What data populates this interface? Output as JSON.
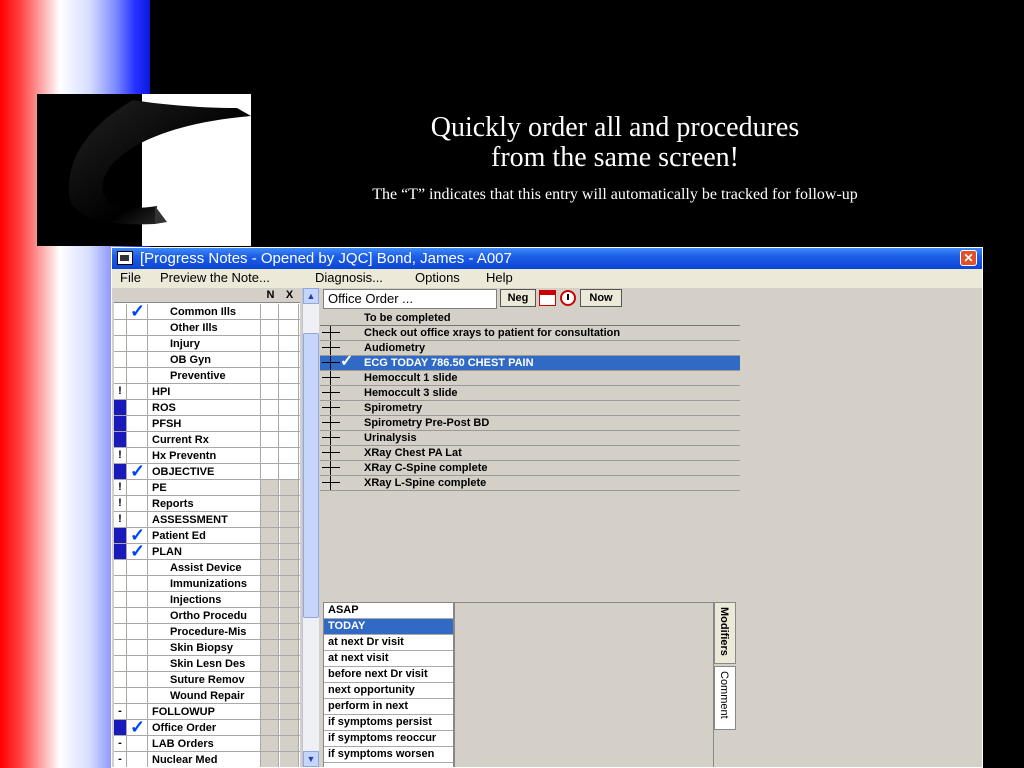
{
  "slide": {
    "title_line1": "Quickly order all and procedures",
    "title_line2": "from the same screen!",
    "subtitle": "The “T” indicates that this entry will automatically be tracked for follow-up"
  },
  "window": {
    "title": "[Progress Notes - Opened by JQC] Bond, James - A007",
    "close_glyph": "✕"
  },
  "menu": [
    "File",
    "Preview the Note...",
    "Diagnosis...",
    "Options",
    "Help"
  ],
  "grid": {
    "header_n": "N",
    "header_x": "X",
    "rows": [
      {
        "flag": "",
        "flag_color": "",
        "check": "✓",
        "label": "Common Ills",
        "indent": true
      },
      {
        "flag": "",
        "flag_color": "",
        "check": "",
        "label": "Other Ills",
        "indent": true
      },
      {
        "flag": "",
        "flag_color": "",
        "check": "",
        "label": "Injury",
        "indent": true
      },
      {
        "flag": "",
        "flag_color": "",
        "check": "",
        "label": "OB Gyn",
        "indent": true
      },
      {
        "flag": "",
        "flag_color": "",
        "check": "",
        "label": "Preventive",
        "indent": true
      },
      {
        "flag": "!",
        "flag_color": "",
        "check": "",
        "label": "HPI",
        "indent": false
      },
      {
        "flag": "",
        "flag_color": "#1a1ab8",
        "check": "",
        "label": "ROS",
        "indent": false
      },
      {
        "flag": "",
        "flag_color": "#1a1ab8",
        "check": "",
        "label": "PFSH",
        "indent": false
      },
      {
        "flag": "",
        "flag_color": "#1a1ab8",
        "check": "",
        "label": "Current Rx",
        "indent": false
      },
      {
        "flag": "!",
        "flag_color": "",
        "check": "",
        "label": "Hx Preventn",
        "indent": false
      },
      {
        "flag": "",
        "flag_color": "#1a1ab8",
        "check": "✓",
        "label": "OBJECTIVE",
        "indent": false
      },
      {
        "flag": "!",
        "flag_color": "",
        "check": "",
        "label": "PE",
        "indent": false
      },
      {
        "flag": "!",
        "flag_color": "",
        "check": "",
        "label": "Reports",
        "indent": false
      },
      {
        "flag": "!",
        "flag_color": "",
        "check": "",
        "label": "ASSESSMENT",
        "indent": false
      },
      {
        "flag": "",
        "flag_color": "#1a1ab8",
        "check": "✓",
        "label": "Patient Ed",
        "indent": false
      },
      {
        "flag": "",
        "flag_color": "#1a1ab8",
        "check": "✓",
        "label": "PLAN",
        "indent": false
      },
      {
        "flag": "",
        "flag_color": "",
        "check": "",
        "label": "Assist Device",
        "indent": true
      },
      {
        "flag": "",
        "flag_color": "",
        "check": "",
        "label": "Immunizations",
        "indent": true
      },
      {
        "flag": "",
        "flag_color": "",
        "check": "",
        "label": "Injections",
        "indent": true
      },
      {
        "flag": "",
        "flag_color": "",
        "check": "",
        "label": "Ortho Procedu",
        "indent": true
      },
      {
        "flag": "",
        "flag_color": "",
        "check": "",
        "label": "Procedure-Mis",
        "indent": true
      },
      {
        "flag": "",
        "flag_color": "",
        "check": "",
        "label": "Skin Biopsy",
        "indent": true
      },
      {
        "flag": "",
        "flag_color": "",
        "check": "",
        "label": "Skin Lesn Des",
        "indent": true
      },
      {
        "flag": "",
        "flag_color": "",
        "check": "",
        "label": "Suture Remov",
        "indent": true
      },
      {
        "flag": "",
        "flag_color": "",
        "check": "",
        "label": "Wound Repair",
        "indent": true
      },
      {
        "flag": "-",
        "flag_color": "",
        "check": "",
        "label": "FOLLOWUP",
        "indent": false
      },
      {
        "flag": "",
        "flag_color": "#1a1ab8",
        "check": "✓",
        "label": "Office Order",
        "indent": false
      },
      {
        "flag": "-",
        "flag_color": "",
        "check": "",
        "label": "LAB Orders",
        "indent": false
      },
      {
        "flag": "-",
        "flag_color": "",
        "check": "",
        "label": "Nuclear Med",
        "indent": false
      }
    ]
  },
  "scroll": {
    "up": "▲",
    "down": "▼"
  },
  "order": {
    "box_label": "Office Order ...",
    "neg_label": "Neg",
    "now_label": "Now",
    "header": "To be completed",
    "items": [
      {
        "text": "Check out office xrays to patient for consultation",
        "checked": false,
        "selected": false
      },
      {
        "text": "Audiometry",
        "checked": false,
        "selected": false
      },
      {
        "text": "ECG TODAY 786.50  CHEST PAIN",
        "checked": true,
        "selected": true
      },
      {
        "text": "Hemoccult 1 slide",
        "checked": false,
        "selected": false
      },
      {
        "text": "Hemoccult 3 slide",
        "checked": false,
        "selected": false
      },
      {
        "text": "Spirometry",
        "checked": false,
        "selected": false
      },
      {
        "text": "Spirometry Pre-Post BD",
        "checked": false,
        "selected": false
      },
      {
        "text": "Urinalysis",
        "checked": false,
        "selected": false
      },
      {
        "text": "XRay Chest PA Lat",
        "checked": false,
        "selected": false
      },
      {
        "text": "XRay C-Spine complete",
        "checked": false,
        "selected": false
      },
      {
        "text": "XRay L-Spine complete",
        "checked": false,
        "selected": false
      }
    ],
    "check_glyph": "✓"
  },
  "modifiers": {
    "items": [
      {
        "text": "ASAP",
        "selected": false
      },
      {
        "text": "TODAY",
        "selected": true
      },
      {
        "text": "at next Dr visit",
        "selected": false
      },
      {
        "text": "at next visit",
        "selected": false
      },
      {
        "text": "before next Dr visit",
        "selected": false
      },
      {
        "text": "next opportunity",
        "selected": false
      },
      {
        "text": "perform in next",
        "selected": false
      },
      {
        "text": "if symptoms persist",
        "selected": false
      },
      {
        "text": "if symptoms reoccur",
        "selected": false
      },
      {
        "text": "if symptoms worsen",
        "selected": false
      }
    ],
    "tab_modifiers": "Modifiers",
    "tab_comment": "Comment"
  }
}
